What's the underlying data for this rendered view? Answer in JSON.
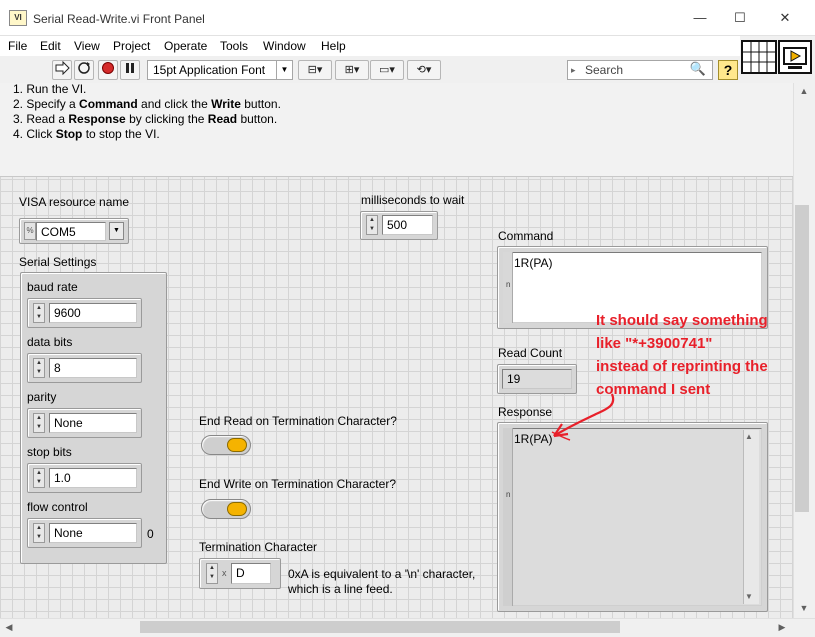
{
  "window": {
    "title": "Serial Read-Write.vi Front Panel",
    "icon_text": "VI",
    "controls": {
      "minimize": "—",
      "maximize": "☐",
      "close": "✕"
    }
  },
  "menu": [
    "File",
    "Edit",
    "View",
    "Project",
    "Operate",
    "Tools",
    "Window",
    "Help"
  ],
  "toolbar": {
    "font": "15pt Application Font",
    "search_placeholder": "Search",
    "help_label": "?"
  },
  "instructions": {
    "line1": "1. Run the VI.",
    "line2_pre": "2. Specify a ",
    "line2_b1": "Command",
    "line2_mid": " and click the ",
    "line2_b2": "Write",
    "line2_post": " button.",
    "line3_pre": "3. Read a ",
    "line3_b1": "Response",
    "line3_mid": " by clicking the ",
    "line3_b2": "Read",
    "line3_post": " button.",
    "line4_pre": "4. Click ",
    "line4_b1": "Stop",
    "line4_post": " to stop the VI."
  },
  "visa": {
    "label": "VISA resource name",
    "value": "COM5"
  },
  "serial_settings": {
    "label": "Serial Settings",
    "baud_rate": {
      "label": "baud rate",
      "value": "9600"
    },
    "data_bits": {
      "label": "data bits",
      "value": "8"
    },
    "parity": {
      "label": "parity",
      "value": "None"
    },
    "stop_bits": {
      "label": "stop bits",
      "value": "1.0"
    },
    "flow_control": {
      "label": "flow control",
      "value": "None",
      "index": "0"
    }
  },
  "wait": {
    "label": "milliseconds to wait",
    "value": "500"
  },
  "end_read": {
    "label": "End Read on Termination Character?"
  },
  "end_write": {
    "label": "End Write on Termination Character?"
  },
  "termination": {
    "label": "Termination Character",
    "radix": "x",
    "value": "D",
    "note_line1": "0xA is equivalent to a '\\n' character,",
    "note_line2": "which is a line feed."
  },
  "command": {
    "label": "Command",
    "value": "1R(PA)",
    "display_indicator": "n"
  },
  "read_count": {
    "label": "Read Count",
    "value": "19"
  },
  "response": {
    "label": "Response",
    "value": "1R(PA)",
    "display_indicator": "n"
  },
  "annotation": {
    "color": "#e8202a",
    "line1": "It should say something",
    "line2": "like \"*+3900741\"",
    "line3": "instead of reprinting the",
    "line4": "command I sent"
  }
}
